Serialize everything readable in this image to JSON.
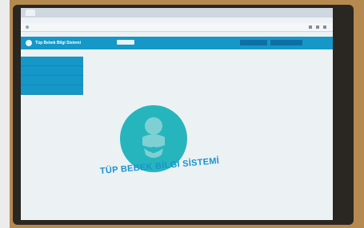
{
  "app": {
    "title": "Tüp Bebek Bilgi Sistemi",
    "hero_title": "TÜP BEBEK BİLGİ SİSTEMİ"
  },
  "header": {
    "buttons": [
      "",
      ""
    ]
  },
  "sidebar": {
    "items": [
      "",
      "",
      "",
      ""
    ]
  },
  "icons": {
    "hero": "baby-icon",
    "logo": "baby-logo-icon"
  },
  "colors": {
    "header": "#1597c8",
    "sidebar": "#1597c8",
    "hero_circle": "#26b5bd",
    "hero_text": "#1a93cf"
  }
}
